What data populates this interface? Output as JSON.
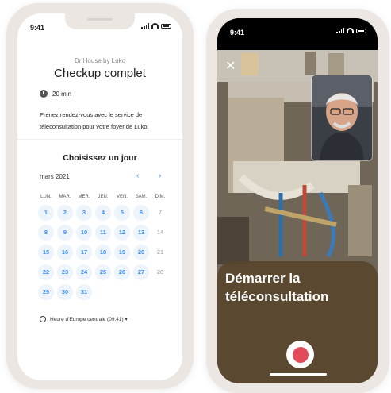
{
  "left": {
    "status_time": "9:41",
    "brand": "Dr House by Luko",
    "title": "Checkup complet",
    "duration": "20 min",
    "description": "Prenez rendez-vous avec le service de téléconsultation pour votre foyer de Luko.",
    "choose_day": "Choisissez un jour",
    "month": "mars 2021",
    "prev_icon": "‹",
    "next_icon": "›",
    "weekdays": [
      "LUN.",
      "MAR.",
      "MER.",
      "JEU.",
      "VEN.",
      "SAM.",
      "DIM."
    ],
    "days": [
      [
        "1",
        "2",
        "3",
        "4",
        "5",
        "6",
        "7"
      ],
      [
        "8",
        "9",
        "10",
        "11",
        "12",
        "13",
        "14"
      ],
      [
        "15",
        "16",
        "17",
        "18",
        "19",
        "20",
        "21"
      ],
      [
        "22",
        "23",
        "24",
        "25",
        "26",
        "27",
        "28"
      ],
      [
        "29",
        "30",
        "31",
        "",
        "",
        "",
        ""
      ]
    ],
    "unavailable": [
      "7",
      "14",
      "21",
      "28"
    ],
    "timezone": "Heure d'Europe centrale (09:41) ▾"
  },
  "right": {
    "status_time": "9:41",
    "close_icon": "✕",
    "cta": "Démarrer la téléconsultation"
  },
  "colors": {
    "accent": "#3b8ef0",
    "accent_bg": "#eef4fb",
    "record": "#e34a5a",
    "card": "#58462a"
  },
  "icons": [
    "clock-icon",
    "globe-icon",
    "close-icon",
    "record-icon",
    "signal-icon",
    "wifi-icon",
    "battery-icon"
  ]
}
